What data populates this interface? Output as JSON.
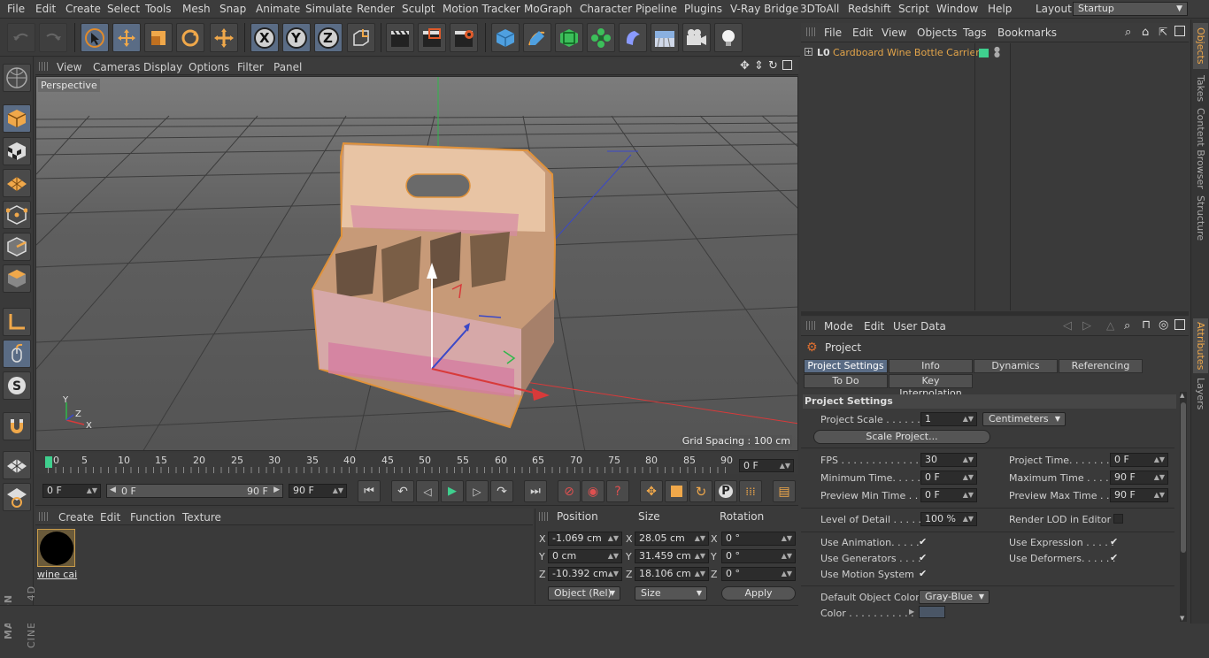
{
  "menubar": {
    "items": [
      "File",
      "Edit",
      "Create",
      "Select",
      "Tools",
      "Mesh",
      "Snap",
      "Animate",
      "Simulate",
      "Render",
      "Sculpt",
      "Motion Tracker",
      "MoGraph",
      "Character",
      "Pipeline",
      "Plugins",
      "V-Ray Bridge",
      "3DToAll",
      "Redshift",
      "Script",
      "Window",
      "Help"
    ],
    "layout_label": "Layout:",
    "layout_value": "Startup"
  },
  "toolbar": {
    "axis_x": "X",
    "axis_y": "Y",
    "axis_z": "Z"
  },
  "viewport": {
    "menu": [
      "View",
      "Cameras",
      "Display",
      "Options",
      "Filter",
      "Panel"
    ],
    "label": "Perspective",
    "grid_spacing": "Grid Spacing : 100 cm",
    "axis_x": "X",
    "axis_y": "Y",
    "axis_z": "Z"
  },
  "timeline": {
    "ticks": [
      "0",
      "5",
      "10",
      "15",
      "20",
      "25",
      "30",
      "35",
      "40",
      "45",
      "50",
      "55",
      "60",
      "65",
      "70",
      "75",
      "80",
      "85",
      "90"
    ],
    "current_frame": "0 F"
  },
  "transport": {
    "start": "0 F",
    "range_start": "0 F",
    "range_end": "90 F",
    "end": "90 F"
  },
  "material": {
    "menu": [
      "Create",
      "Edit",
      "Function",
      "Texture"
    ],
    "name": "wine cai"
  },
  "coords": {
    "head_position": "Position",
    "head_size": "Size",
    "head_rotation": "Rotation",
    "axes": [
      "X",
      "Y",
      "Z"
    ],
    "position": [
      "-1.069 cm",
      "0 cm",
      "-10.392 cm"
    ],
    "size": [
      "28.05 cm",
      "31.459 cm",
      "18.106 cm"
    ],
    "rotation": [
      "0 °",
      "0 °",
      "0 °"
    ],
    "size_axes": [
      "X",
      "Y",
      "Z"
    ],
    "rot_axes": [
      "X",
      "Y",
      "Z"
    ],
    "mode": "Object (Rel)",
    "size_mode": "Size",
    "apply": "Apply"
  },
  "objects": {
    "menu": [
      "File",
      "Edit",
      "View",
      "Objects",
      "Tags",
      "Bookmarks"
    ],
    "item": "Cardboard Wine Bottle Carrier",
    "item_color": "#e2a44a"
  },
  "attributes": {
    "menu": [
      "Mode",
      "Edit",
      "User Data"
    ],
    "title": "Project",
    "tabs_row1": [
      "Project Settings",
      "Info",
      "Dynamics",
      "Referencing"
    ],
    "tabs_row2": [
      "To Do",
      "Key Interpolation"
    ],
    "section": "Project Settings",
    "project_scale_label": "Project Scale . . . . . .",
    "project_scale_value": "1",
    "project_scale_unit": "Centimeters",
    "scale_project_btn": "Scale Project...",
    "fps_label": "FPS . . . . . . . . . . . . . .",
    "fps_value": "30",
    "project_time_label": "Project Time. . . . . . . .",
    "project_time_value": "0 F",
    "min_time_label": "Minimum Time. . . . . .",
    "min_time_value": "0 F",
    "max_time_label": "Maximum Time . . . . . .",
    "max_time_value": "90 F",
    "prev_min_label": "Preview Min Time . .",
    "prev_min_value": "0 F",
    "prev_max_label": "Preview Max Time . . .",
    "prev_max_value": "90 F",
    "lod_label": "Level of Detail . . . . .",
    "lod_value": "100 %",
    "render_lod_label": "Render LOD in Editor",
    "use_animation_label": "Use Animation. . . . .",
    "use_expression_label": "Use Expression . . . . .",
    "use_generators_label": "Use Generators . . . .",
    "use_deformers_label": "Use Deformers. . . . . .",
    "use_motion_label": "Use Motion System",
    "check": "✔",
    "default_color_label": "Default Object Color",
    "default_color_value": "Gray-Blue",
    "color_label": "Color . . . . . . . . . . ."
  },
  "side_tabs": [
    "Objects",
    "Takes",
    "Content Browser",
    "Structure",
    "Attributes",
    "Layers"
  ],
  "colors": {
    "accent": "#5a6c85",
    "highlight": "#f0a84a",
    "swatch": "#4a5666",
    "status_green": "#3fcf8e"
  }
}
